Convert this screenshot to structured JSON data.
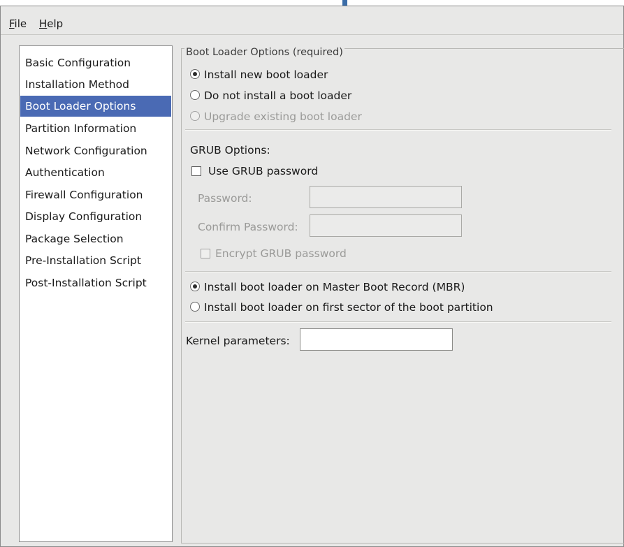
{
  "menu": {
    "file": {
      "mnemonic": "F",
      "rest": "ile"
    },
    "help": {
      "mnemonic": "H",
      "rest": "elp"
    }
  },
  "sidebar": {
    "items": [
      {
        "label": "Basic Configuration"
      },
      {
        "label": "Installation Method"
      },
      {
        "label": "Boot Loader Options",
        "selected": true
      },
      {
        "label": "Partition Information"
      },
      {
        "label": "Network Configuration"
      },
      {
        "label": "Authentication"
      },
      {
        "label": "Firewall Configuration"
      },
      {
        "label": "Display Configuration"
      },
      {
        "label": "Package Selection"
      },
      {
        "label": "Pre-Installation Script"
      },
      {
        "label": "Post-Installation Script"
      }
    ]
  },
  "boot_loader": {
    "group_title": "Boot Loader Options (required)",
    "options": [
      {
        "label": "Install new boot loader",
        "checked": true,
        "enabled": true
      },
      {
        "label": "Do not install a boot loader",
        "checked": false,
        "enabled": true
      },
      {
        "label": "Upgrade existing boot loader",
        "checked": false,
        "enabled": false
      }
    ]
  },
  "grub": {
    "title": "GRUB Options:",
    "use_password_label": "Use GRUB password",
    "use_password_checked": false,
    "password_label": "Password:",
    "password_value": "",
    "confirm_label": "Confirm Password:",
    "confirm_value": "",
    "encrypt_label": "Encrypt GRUB password",
    "encrypt_checked": false
  },
  "install_location": {
    "options": [
      {
        "label": "Install boot loader on Master Boot Record (MBR)",
        "checked": true
      },
      {
        "label": "Install boot loader on first sector of the boot partition",
        "checked": false
      }
    ]
  },
  "kernel": {
    "label": "Kernel parameters:",
    "value": ""
  },
  "colors": {
    "selection": "#4a6ab4",
    "window_bg": "#e8e8e7"
  }
}
